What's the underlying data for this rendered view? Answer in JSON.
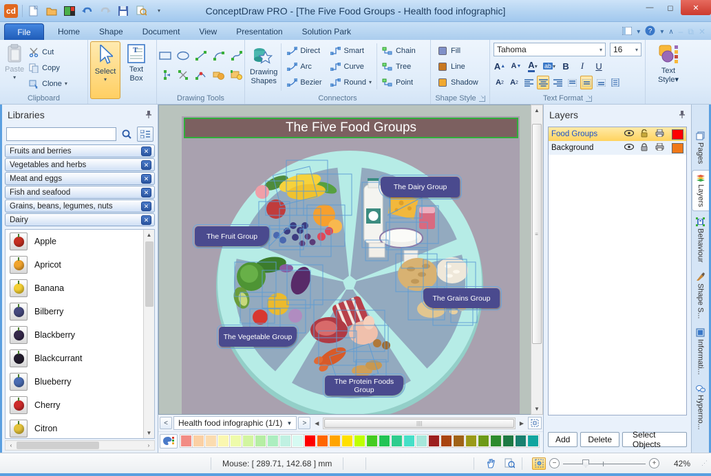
{
  "window": {
    "title": "ConceptDraw PRO - [The Five Food Groups - Health food infographic]"
  },
  "tabs": {
    "file": "File",
    "items": [
      "Home",
      "Shape",
      "Document",
      "View",
      "Presentation",
      "Solution Park"
    ]
  },
  "ribbon": {
    "clipboard": {
      "label": "Clipboard",
      "paste": "Paste",
      "cut": "Cut",
      "copy": "Copy",
      "clone": "Clone"
    },
    "select": {
      "label": "Select"
    },
    "textbox": {
      "line1": "Text",
      "line2": "Box"
    },
    "drawing_tools": {
      "label": "Drawing Tools"
    },
    "drawing_shapes": {
      "line1": "Drawing",
      "line2": "Shapes"
    },
    "connectors": {
      "label": "Connectors",
      "col1": [
        "Direct",
        "Arc",
        "Bezier"
      ],
      "col2": [
        {
          "label": "Smart",
          "caret": ""
        },
        {
          "label": "Curve",
          "caret": ""
        },
        {
          "label": "Round",
          "caret": "▾"
        }
      ],
      "col3": [
        "Chain",
        "Tree",
        "Point"
      ]
    },
    "shape_style": {
      "label": "Shape Style",
      "items": [
        {
          "label": "Fill",
          "color": "#8090c8"
        },
        {
          "label": "Line",
          "color": "#c87820"
        },
        {
          "label": "Shadow",
          "color": "#f0a830"
        }
      ]
    },
    "text_format": {
      "label": "Text Format",
      "font": "Tahoma",
      "size": "16",
      "bold": "B",
      "italic": "I",
      "underline": "U"
    },
    "text_style": {
      "line1": "Text",
      "line2": "Style▾"
    }
  },
  "libraries": {
    "title": "Libraries",
    "tabs": [
      "Fruits and berries",
      "Vegetables and herbs",
      "Meat and eggs",
      "Fish and seafood",
      "Grains, beans, legumes, nuts",
      "Dairy"
    ],
    "items": [
      {
        "label": "Apple",
        "color": "#c52f21"
      },
      {
        "label": "Apricot",
        "color": "#f0a32c"
      },
      {
        "label": "Banana",
        "color": "#f3cf34"
      },
      {
        "label": "Bilberry",
        "color": "#45497e"
      },
      {
        "label": "Blackberry",
        "color": "#35284a"
      },
      {
        "label": "Blackcurrant",
        "color": "#241d2e"
      },
      {
        "label": "Blueberry",
        "color": "#4a6cb2"
      },
      {
        "label": "Cherry",
        "color": "#cd2b2b"
      },
      {
        "label": "Citron",
        "color": "#e3c23b"
      }
    ]
  },
  "canvas": {
    "title": "The Five Food Groups",
    "groups": [
      "The Dairy Group",
      "The Fruit Group",
      "The Grains Group",
      "The Vegetable Group",
      "The Protein Foods Group"
    ]
  },
  "page_nav": {
    "prev": "<",
    "next": ">",
    "label": "Health food infographic (1/1)"
  },
  "palette": [
    "#f28c84",
    "#fbd0a4",
    "#fbdcb0",
    "#faf7b0",
    "#eefbaa",
    "#d2f5a0",
    "#b6eea4",
    "#aceec0",
    "#c0f1e2",
    "#d6faf2",
    "#fe0000",
    "#ff6600",
    "#ffa400",
    "#ffe000",
    "#bfff00",
    "#44cc22",
    "#22c455",
    "#2ecc8e",
    "#45dfc8",
    "#a6e7db",
    "#9c1f1f",
    "#a94410",
    "#a06318",
    "#9a9a18",
    "#6d9a18",
    "#2d8b2d",
    "#1e7944",
    "#19806f",
    "#11a59f"
  ],
  "layers": {
    "title": "Layers",
    "rows": [
      {
        "name": "Food Groups",
        "color": "#ff0000"
      },
      {
        "name": "Background",
        "color": "#f07818"
      }
    ],
    "add": "Add",
    "delete": "Delete",
    "select_objects": "Select Objects"
  },
  "side_tabs": [
    "Pages",
    "Layers",
    "Behaviour",
    "Shape S...",
    "Informati...",
    "Hyperno..."
  ],
  "status": {
    "mouse": "Mouse: [ 289.71, 142.68 ] mm",
    "zoom": "42%"
  }
}
